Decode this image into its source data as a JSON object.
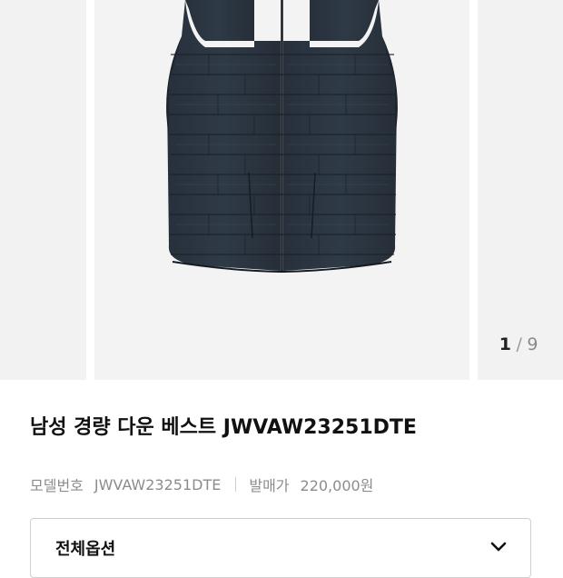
{
  "gallery": {
    "current": "1",
    "separator": "/",
    "total": "9",
    "image_icon": "vest-photo"
  },
  "product": {
    "title": "남성 경량 다운 베스트 JWVAW23251DTE",
    "model_label": "모델번호",
    "model_value": "JWVAW23251DTE",
    "price_label": "발매가",
    "price_value": "220,000원"
  },
  "options": {
    "label": "전체옵션",
    "icon": "chevron-down-icon"
  },
  "colors": {
    "vest": "#2a3440",
    "background_panel": "#f2f2f2"
  }
}
